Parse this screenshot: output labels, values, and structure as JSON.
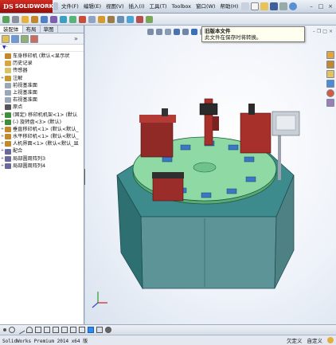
{
  "app": {
    "logo_text": "SOLIDWORKS",
    "logo_mark": "DS",
    "menu": [
      {
        "label": "文件(F)"
      },
      {
        "label": "编辑(E)"
      },
      {
        "label": "视图(V)"
      },
      {
        "label": "插入(I)"
      },
      {
        "label": "工具(T)"
      },
      {
        "label": "Toolbox"
      },
      {
        "label": "窗口(W)"
      },
      {
        "label": "帮助(H)"
      }
    ]
  },
  "tooltip": {
    "title": "旧版本文件",
    "body": "此文件在保存时将转换。"
  },
  "left_panel": {
    "tabs": [
      "装配体",
      "布局",
      "草图"
    ],
    "active_tab": 0,
    "filter_icon": "filter-icon",
    "tree": [
      {
        "label": "车身移印机  (默认<显示状",
        "icon": "assembly-icon",
        "color": "#c2882a",
        "expand": ""
      },
      {
        "label": "历史记录",
        "icon": "history-icon",
        "color": "#d9a441",
        "expand": ""
      },
      {
        "label": "传感器",
        "icon": "sensor-icon",
        "color": "#d7c36a",
        "expand": ""
      },
      {
        "label": "注解",
        "icon": "annotation-icon",
        "color": "#c9982c",
        "expand": "+"
      },
      {
        "label": "前视基准面",
        "icon": "plane-icon",
        "color": "#9aa7b8",
        "expand": ""
      },
      {
        "label": "上视基准面",
        "icon": "plane-icon",
        "color": "#9aa7b8",
        "expand": ""
      },
      {
        "label": "右视基准面",
        "icon": "plane-icon",
        "color": "#9aa7b8",
        "expand": ""
      },
      {
        "label": "原点",
        "icon": "origin-icon",
        "color": "#555555",
        "expand": ""
      },
      {
        "label": "(固定) 移印机机架<1> (默认",
        "icon": "part-icon",
        "color": "#3f8f3a",
        "expand": "+"
      },
      {
        "label": "(-) 旋转盘<3> (默认)",
        "icon": "part-icon",
        "color": "#3f8f3a",
        "expand": "+"
      },
      {
        "label": "垂直移印机<1> (默认<默认_",
        "icon": "subassembly-icon",
        "color": "#c2882a",
        "expand": "+"
      },
      {
        "label": "水平移印机<1> (默认<默认_",
        "icon": "subassembly-icon",
        "color": "#c2882a",
        "expand": "+"
      },
      {
        "label": "人机界面<1> (默认<默认_显",
        "icon": "subassembly-icon",
        "color": "#c2882a",
        "expand": "+"
      },
      {
        "label": "配合",
        "icon": "mates-icon",
        "color": "#6a6a9a",
        "expand": "+"
      },
      {
        "label": "局部圆周阵列3",
        "icon": "pattern-icon",
        "color": "#6a6a9a",
        "expand": "+"
      },
      {
        "label": "局部圆周阵列4",
        "icon": "pattern-icon",
        "color": "#6a6a9a",
        "expand": "+"
      }
    ]
  },
  "status": {
    "product": "SolidWorks Premium 2014 x64 版",
    "state": "欠定义",
    "mode": "自定义"
  },
  "colors": {
    "base_teal": "#3e8b8e",
    "table_green": "#8ed9a4",
    "station_red": "#a8302b"
  }
}
